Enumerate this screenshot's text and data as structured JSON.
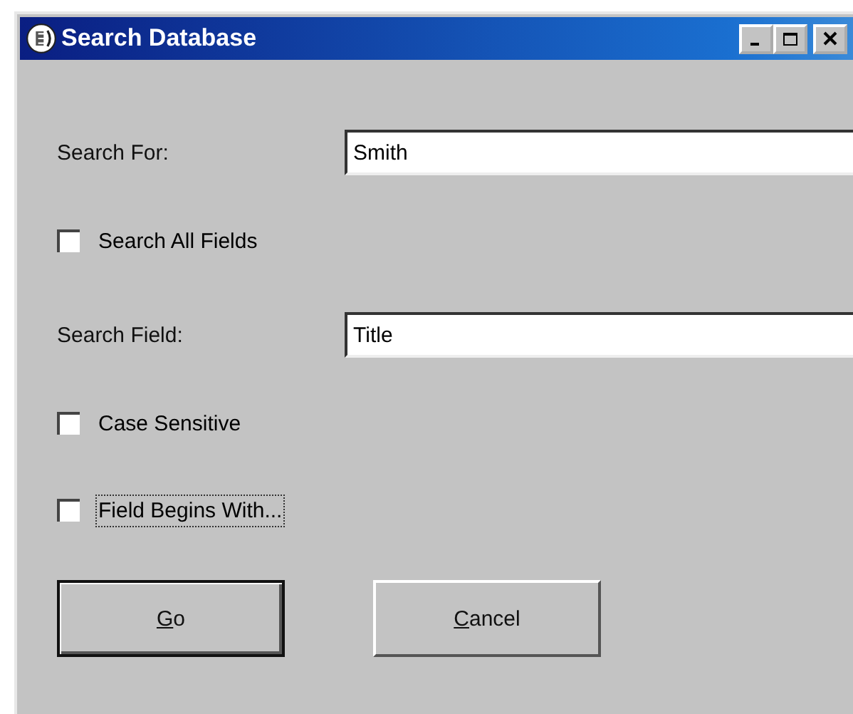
{
  "window": {
    "title": "Search Database"
  },
  "title_buttons": [
    {
      "kind": "minimize"
    },
    {
      "kind": "maximize"
    },
    {
      "kind": "close"
    }
  ],
  "rows": [
    {
      "kind": "field",
      "label": "Search For:",
      "value": "Smith"
    },
    {
      "kind": "checkbox",
      "label": "Search All Fields",
      "checked": false,
      "focused": false
    },
    {
      "kind": "field",
      "label": "Search Field:",
      "value": "Title"
    },
    {
      "kind": "checkbox",
      "label": "Case Sensitive",
      "checked": false,
      "focused": false
    },
    {
      "kind": "checkbox",
      "label": "Field Begins With...",
      "checked": false,
      "focused": true
    }
  ],
  "buttons": [
    {
      "label": "Go",
      "default": true
    },
    {
      "label": "Cancel",
      "default": false
    }
  ]
}
